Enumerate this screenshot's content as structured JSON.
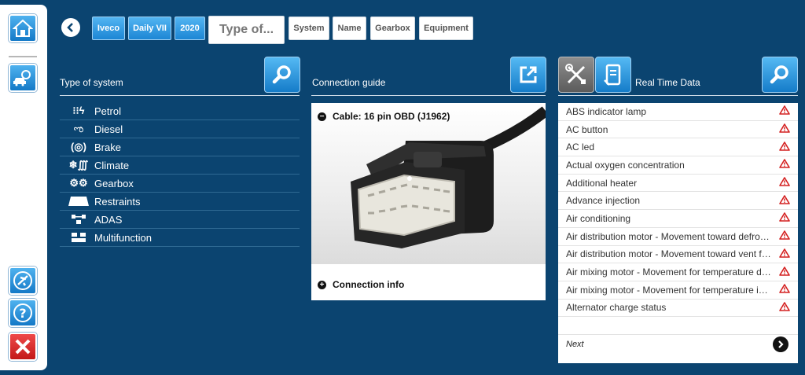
{
  "breadcrumb": {
    "items": [
      "Iveco",
      "Daily VII",
      "2020"
    ],
    "type_of": "Type of...",
    "filters": [
      "System",
      "Name",
      "Gearbox",
      "Equipment"
    ]
  },
  "columns": {
    "system_title": "Type of system",
    "guide_title": "Connection guide",
    "rtd_title": "Real Time Data"
  },
  "systems": [
    {
      "label": "Petrol",
      "icon": "petrol-icon"
    },
    {
      "label": "Diesel",
      "icon": "diesel-icon"
    },
    {
      "label": "Brake",
      "icon": "brake-icon"
    },
    {
      "label": "Climate",
      "icon": "climate-icon"
    },
    {
      "label": "Gearbox",
      "icon": "gearbox-icon"
    },
    {
      "label": "Restraints",
      "icon": "restraints-icon"
    },
    {
      "label": "ADAS",
      "icon": "adas-icon"
    },
    {
      "label": "Multifunction",
      "icon": "multifunction-icon"
    }
  ],
  "guide": {
    "cable": "Cable: 16 pin OBD (J1962)",
    "info": "Connection info"
  },
  "rtd": {
    "items": [
      "ABS indicator lamp",
      "AC button",
      "AC led",
      "Actual oxygen concentration",
      "Additional heater",
      "Advance injection",
      "Air conditioning",
      "Air distribution motor - Movement toward defro…",
      "Air distribution motor - Movement toward vent f…",
      "Air mixing motor - Movement for temperature d…",
      "Air mixing motor - Movement for temperature i…",
      "Alternator charge status"
    ],
    "next": "Next"
  },
  "colors": {
    "background": "#0b4470",
    "accent": "#1c86d4",
    "warning": "#d42020"
  }
}
